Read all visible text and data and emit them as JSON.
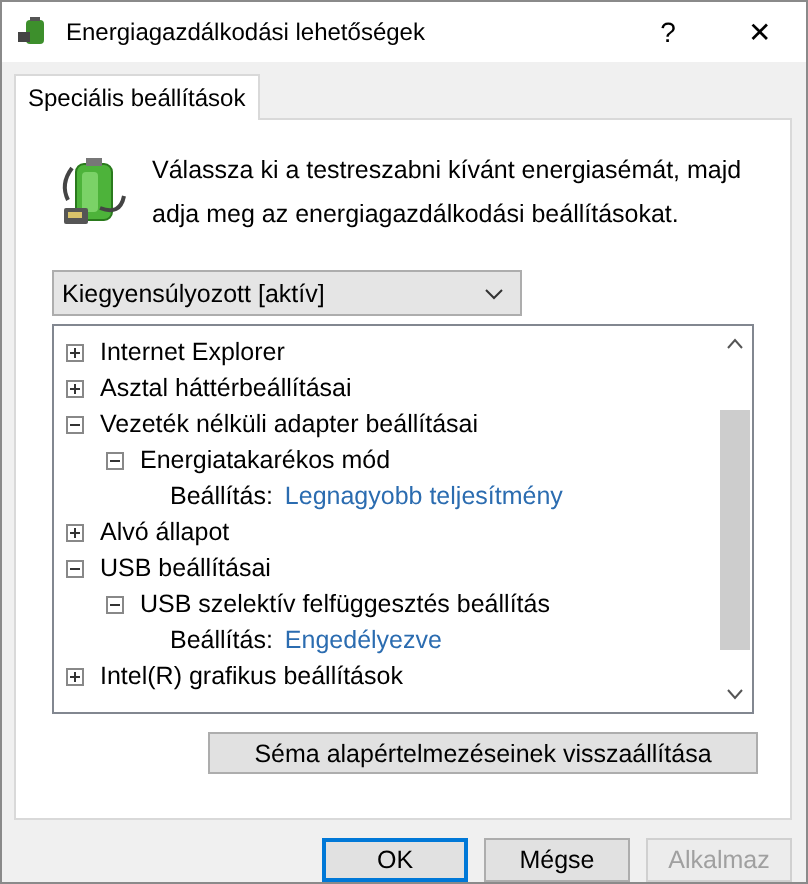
{
  "window": {
    "title": "Energiagazdálkodási lehetőségek",
    "help_button": "?",
    "close_button": "✕"
  },
  "tabs": [
    {
      "label": "Speciális beállítások",
      "selected": true
    }
  ],
  "description": "Válassza ki a testreszabni kívánt energiasémát, majd adja meg az energiagazdálkodási beállításokat.",
  "plan_dropdown": {
    "value": "Kiegyensúlyozott [aktív]"
  },
  "tree": [
    {
      "kind": "group",
      "label": "Internet Explorer",
      "expanded": false
    },
    {
      "kind": "group",
      "label": "Asztal háttérbeállításai",
      "expanded": false
    },
    {
      "kind": "group",
      "label": "Vezeték nélküli adapter beállításai",
      "expanded": true,
      "children": [
        {
          "kind": "group",
          "label": "Energiatakarékos mód",
          "expanded": true,
          "children": [
            {
              "kind": "setting",
              "label": "Beállítás:",
              "value": "Legnagyobb teljesítmény"
            }
          ]
        }
      ]
    },
    {
      "kind": "group",
      "label": "Alvó állapot",
      "expanded": false
    },
    {
      "kind": "group",
      "label": "USB beállításai",
      "expanded": true,
      "children": [
        {
          "kind": "group",
          "label": "USB szelektív felfüggesztés beállítás",
          "expanded": true,
          "children": [
            {
              "kind": "setting",
              "label": "Beállítás:",
              "value": "Engedélyezve"
            }
          ]
        }
      ]
    },
    {
      "kind": "group",
      "label": "Intel(R) grafikus beállítások",
      "expanded": false
    }
  ],
  "restore_button": "Séma alapértelmezéseinek visszaállítása",
  "buttons": [
    {
      "label": "OK",
      "disabled": false,
      "default": true
    },
    {
      "label": "Mégse",
      "disabled": false,
      "default": false
    },
    {
      "label": "Alkalmaz",
      "disabled": true,
      "default": false
    }
  ]
}
